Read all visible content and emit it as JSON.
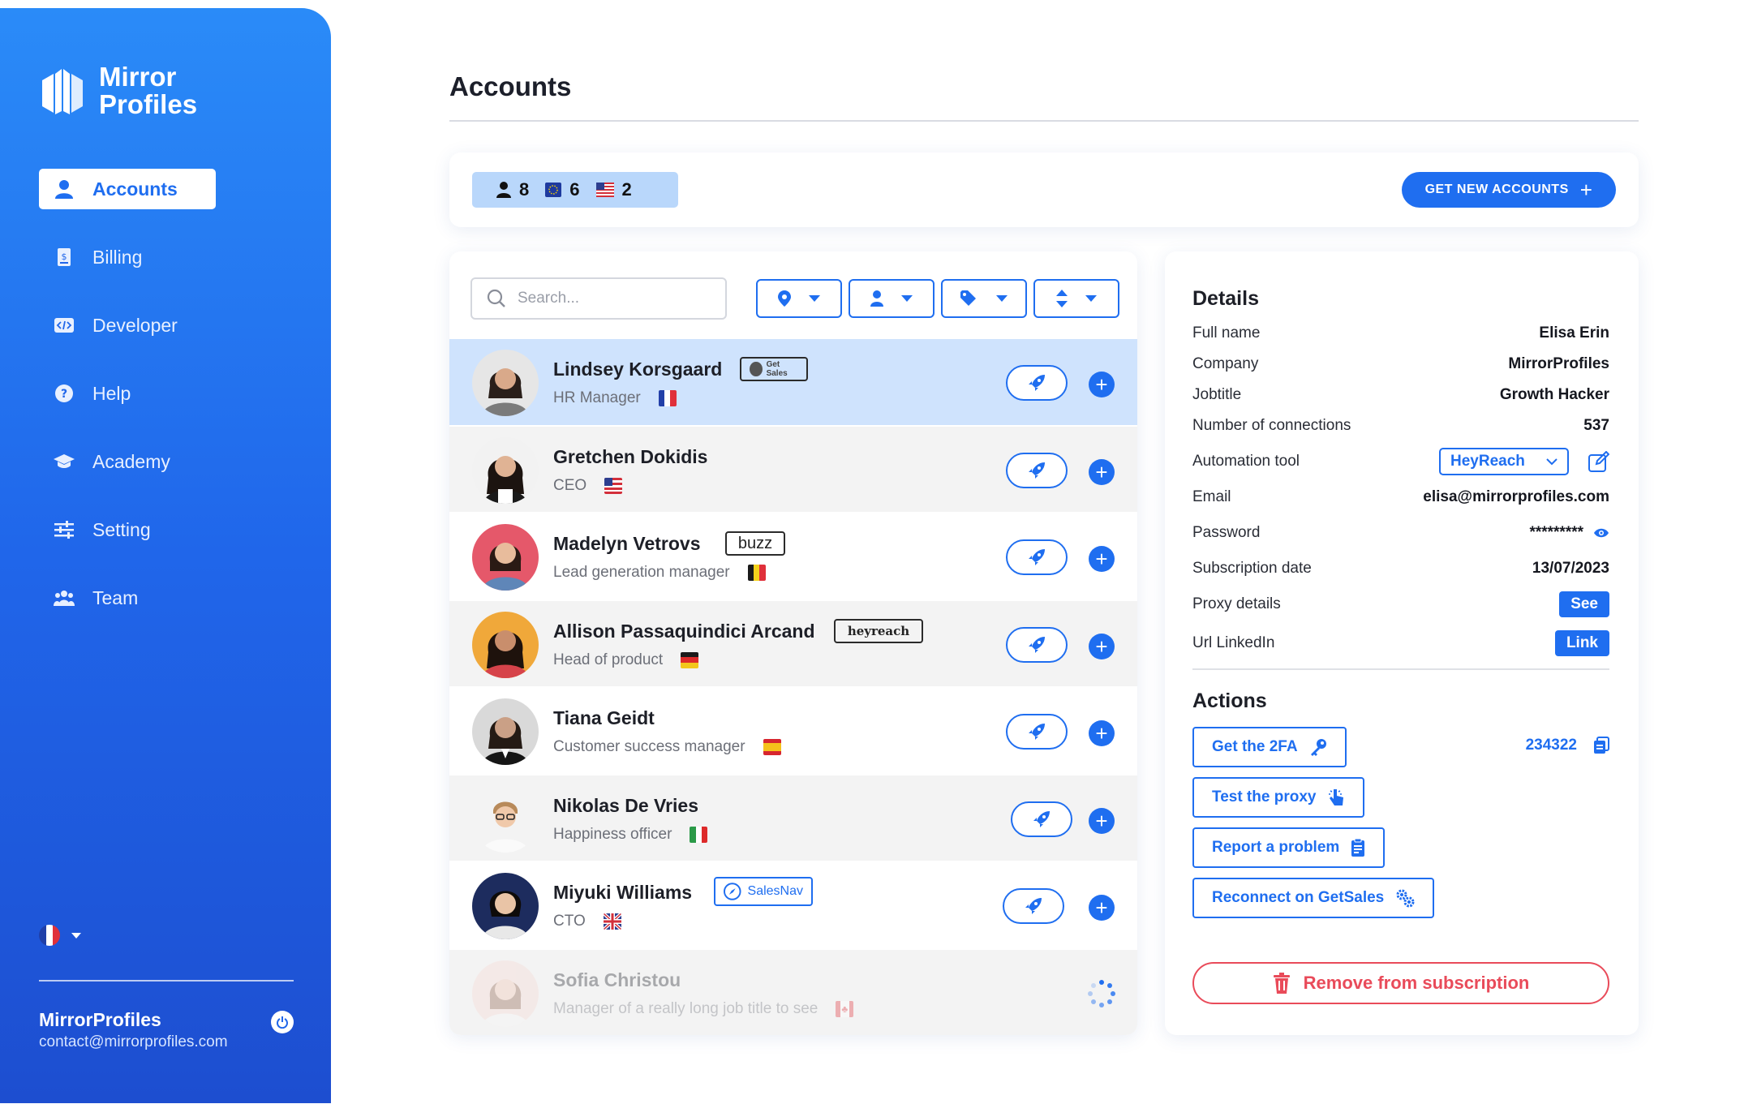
{
  "app": {
    "brand_line1": "Mirror",
    "brand_line2": "Profiles"
  },
  "sidebar": {
    "items": [
      {
        "label": "Accounts",
        "icon": "user-icon",
        "active": true
      },
      {
        "label": "Billing",
        "icon": "invoice-icon",
        "active": false
      },
      {
        "label": "Developer",
        "icon": "code-icon",
        "active": false
      },
      {
        "label": "Help",
        "icon": "help-icon",
        "active": false
      },
      {
        "label": "Academy",
        "icon": "graduation-cap-icon",
        "active": false
      },
      {
        "label": "Setting",
        "icon": "sliders-icon",
        "active": false
      },
      {
        "label": "Team",
        "icon": "team-icon",
        "active": false
      }
    ],
    "language_flag": "FR",
    "user": {
      "name": "MirrorProfiles",
      "email": "contact@mirrorprofiles.com"
    }
  },
  "page": {
    "title": "Accounts"
  },
  "stats": {
    "total": "8",
    "eu": "6",
    "us": "2"
  },
  "topbar": {
    "get_new_label": "GET NEW ACCOUNTS"
  },
  "search": {
    "placeholder": "Search..."
  },
  "accounts": [
    {
      "name": "Lindsey Korsgaard",
      "role": "HR Manager",
      "flag": "FR",
      "tool": "Get Sales",
      "selected": true
    },
    {
      "name": "Gretchen Dokidis",
      "role": "CEO",
      "flag": "US",
      "tool": ""
    },
    {
      "name": "Madelyn Vetrovs",
      "role": "Lead generation manager",
      "flag": "BE",
      "tool": "buzz"
    },
    {
      "name": "Allison Passaquindici Arcand",
      "role": "Head of product",
      "flag": "DE",
      "tool": "heyreach"
    },
    {
      "name": "Tiana Geidt",
      "role": "Customer success manager",
      "flag": "ES",
      "tool": ""
    },
    {
      "name": "Nikolas De Vries",
      "role": "Happiness officer",
      "flag": "IT",
      "tool": ""
    },
    {
      "name": "Miyuki Williams",
      "role": "CTO",
      "flag": "GB",
      "tool": "SalesNav"
    },
    {
      "name": "Sofia Christou",
      "role": "Manager of a really long job title to see",
      "flag": "CA",
      "tool": "",
      "loading": true
    }
  ],
  "details": {
    "title": "Details",
    "rows": [
      {
        "label": "Full name",
        "value": "Elisa Erin"
      },
      {
        "label": "Company",
        "value": "MirrorProfiles"
      },
      {
        "label": "Jobtitle",
        "value": "Growth Hacker"
      },
      {
        "label": "Number of connections",
        "value": "537"
      }
    ],
    "automation_label": "Automation tool",
    "automation_value": "HeyReach",
    "email_label": "Email",
    "email_value": "elisa@mirrorprofiles.com",
    "password_label": "Password",
    "password_value": "*********",
    "subscription_label": "Subscription date",
    "subscription_value": "13/07/2023",
    "proxy_label": "Proxy details",
    "proxy_button": "See",
    "linkedin_label": "Url LinkedIn",
    "linkedin_button": "Link"
  },
  "actions": {
    "title": "Actions",
    "get_2fa": "Get the 2FA",
    "code": "234322",
    "test_proxy": "Test the proxy",
    "report": "Report a problem",
    "reconnect": "Reconnect on GetSales",
    "remove": "Remove from subscription"
  },
  "colors": {
    "primary": "#1f6ef0",
    "danger": "#e94b5a",
    "selected_row": "#cfe3fd"
  }
}
